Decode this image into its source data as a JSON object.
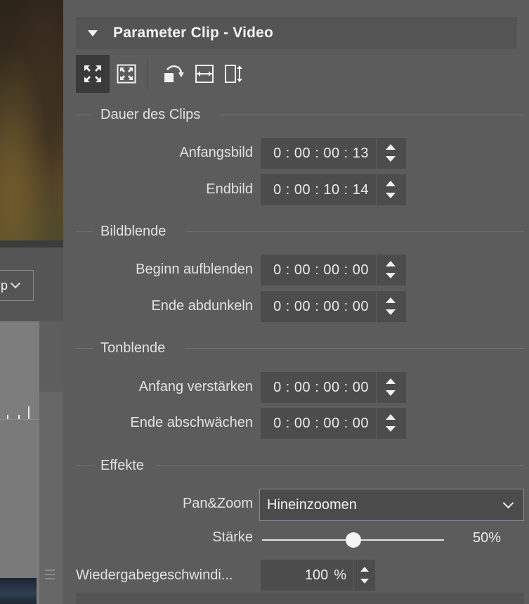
{
  "left": {
    "mode_select_value": "p"
  },
  "panel": {
    "title": "Parameter Clip - Video",
    "toolbar": {
      "buttons": [
        "fill-frame-icon",
        "fit-frame-icon",
        "rotate-icon",
        "flip-horizontal-icon",
        "flip-vertical-icon"
      ],
      "active": "fill-frame-icon"
    },
    "clip_duration": {
      "heading": "Dauer des Clips",
      "start_label": "Anfangsbild",
      "start_value": "0 : 00 : 00 : 13",
      "end_label": "Endbild",
      "end_value": "0 : 00 : 10 : 14"
    },
    "image_fade": {
      "heading": "Bildblende",
      "fade_in_label": "Beginn aufblenden",
      "fade_in_value": "0 : 00 : 00 : 00",
      "fade_out_label": "Ende abdunkeln",
      "fade_out_value": "0 : 00 : 00 : 00"
    },
    "audio_fade": {
      "heading": "Tonblende",
      "fade_in_label": "Anfang verstärken",
      "fade_in_value": "0 : 00 : 00 : 00",
      "fade_out_label": "Ende abschwächen",
      "fade_out_value": "0 : 00 : 00 : 00"
    },
    "effects": {
      "heading": "Effekte",
      "panzoom_label": "Pan&Zoom",
      "panzoom_value": "Hineinzoomen",
      "strength_label": "Stärke",
      "strength_percent": 50,
      "strength_text": "50%"
    },
    "speed": {
      "label": "Wiedergabegeschwindi...",
      "value": "100",
      "unit": "%"
    }
  },
  "colors": {
    "panel_bg": "#5c5c5c",
    "field_bg": "#4c4c4c",
    "select_border": "#7d8ea3",
    "text": "#e2e2e2"
  }
}
